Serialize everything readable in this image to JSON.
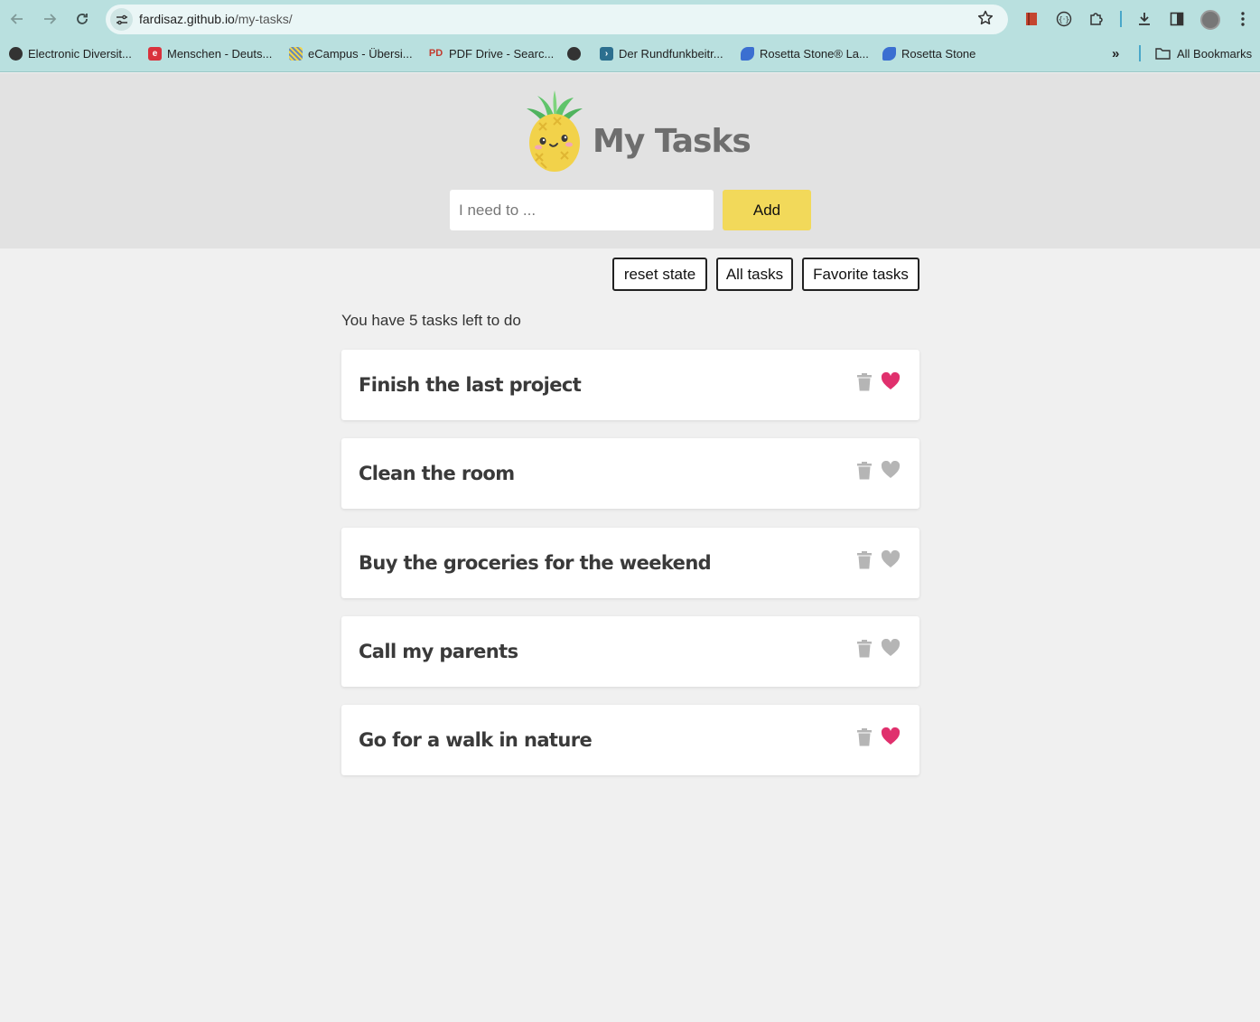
{
  "browser": {
    "url_host": "fardisaz.github.io",
    "url_path": "/my-tasks/",
    "bookmarks": [
      {
        "label": "Electronic Diversit...",
        "icon": "globe-icon",
        "color": "#333333"
      },
      {
        "label": "Menschen - Deuts...",
        "icon": "e-icon",
        "color": "#d9323c"
      },
      {
        "label": "eCampus - Übersi...",
        "icon": "ecampus-icon",
        "color": "#6a8ab5"
      },
      {
        "label": "PDF Drive - Searc...",
        "icon": "pdf-icon",
        "color": "#c23a2e"
      },
      {
        "label": "",
        "icon": "globe-icon",
        "color": "#333333"
      },
      {
        "label": "Der Rundfunkbeitr...",
        "icon": "chevron-icon",
        "color": "#2c6f8f"
      },
      {
        "label": "Rosetta Stone® La...",
        "icon": "rosetta-icon",
        "color": "#3b6fd1"
      },
      {
        "label": "Rosetta Stone",
        "icon": "rosetta-icon",
        "color": "#3b6fd1"
      }
    ],
    "all_bookmarks_label": "All Bookmarks"
  },
  "app": {
    "title": "My Tasks",
    "input_placeholder": "I need to ...",
    "input_value": "",
    "add_label": "Add",
    "filters": {
      "reset_label": "reset state",
      "all_label": "All tasks",
      "favorite_label": "Favorite tasks"
    },
    "tasks_left_text": "You have 5 tasks left to do",
    "colors": {
      "accent": "#f2d95a",
      "favorite": "#e0306d",
      "muted_icon": "#b5b5b5"
    },
    "tasks": [
      {
        "title": "Finish the last project",
        "favorite": true
      },
      {
        "title": "Clean the room",
        "favorite": false
      },
      {
        "title": "Buy the groceries for the weekend",
        "favorite": false
      },
      {
        "title": "Call my parents",
        "favorite": false
      },
      {
        "title": "Go for a walk in nature",
        "favorite": true
      }
    ]
  }
}
